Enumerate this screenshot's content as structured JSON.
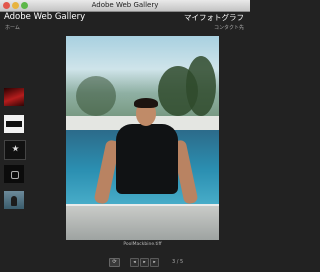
{
  "window": {
    "title": "Adobe Web Gallery"
  },
  "header": {
    "gallery_name": "Adobe Web Gallery",
    "site_title": "マイフォトグラフ"
  },
  "nav": {
    "home": "ホーム",
    "contact": "コンタクト先"
  },
  "thumbnails": [
    {
      "icon": "red-car-thumb"
    },
    {
      "icon": "text-logo-thumb"
    },
    {
      "icon": "star-logo-thumb"
    },
    {
      "icon": "dark-logo-thumb"
    },
    {
      "icon": "person-thumb"
    }
  ],
  "main_photo": {
    "caption": "PoolMackbine.tiff"
  },
  "controls": {
    "refresh": "⟳",
    "prev": "◂",
    "play": "▸",
    "next": "▸",
    "counter": "3 / 5"
  }
}
